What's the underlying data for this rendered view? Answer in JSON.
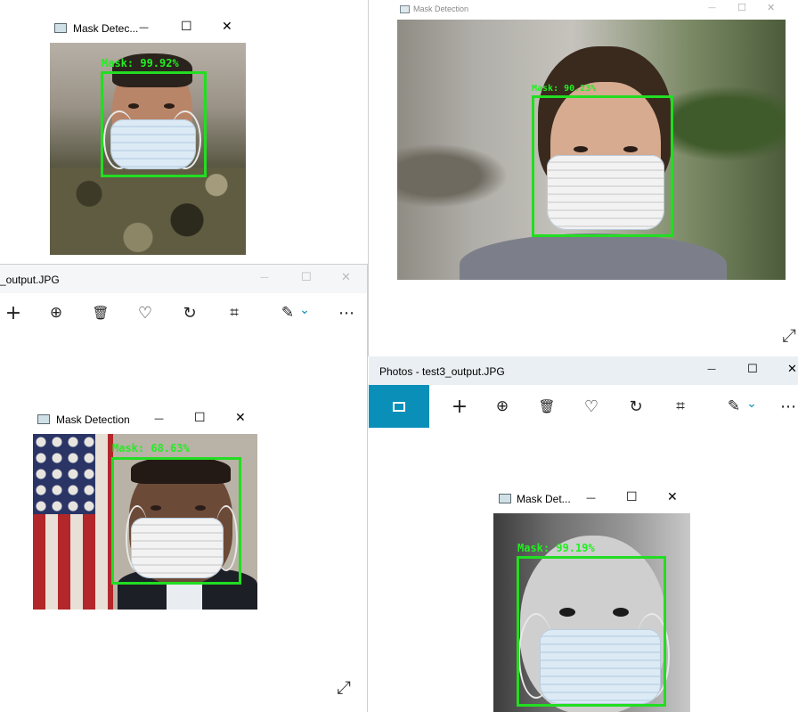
{
  "colors": {
    "detection": "#22dd22",
    "photos_accent": "#0a8fb8",
    "photos_titlebar": "#e8eef2"
  },
  "win_top_left": {
    "title": "Mask Detec...",
    "label": "Mask: 99.92%",
    "minimize_glyph": "—",
    "maximize_glyph": "☐",
    "close_glyph": "✕"
  },
  "win_top_right": {
    "title": "Mask Detection",
    "label": "Mask: 90.23%",
    "minimize_glyph": "—",
    "maximize_glyph": "☐",
    "close_glyph": "✕"
  },
  "photos_left": {
    "title": "_output.JPG",
    "minimize_glyph": "—",
    "maximize_glyph": "☐",
    "close_glyph": "✕",
    "expand_glyph": "⤢",
    "toolbar": [
      "add-icon",
      "zoom-in-icon",
      "delete-icon",
      "favorite-icon",
      "rotate-icon",
      "crop-icon",
      "edit-icon",
      "more-icon"
    ],
    "inner_window": {
      "title": "Mask Detection",
      "label": "Mask: 68.63%",
      "minimize_glyph": "—",
      "maximize_glyph": "☐",
      "close_glyph": "✕"
    }
  },
  "photos_right": {
    "title": "Photos - test3_output.JPG",
    "minimize_glyph": "—",
    "maximize_glyph": "☐",
    "close_glyph": "✕",
    "toolbar": [
      "image-icon",
      "add-icon",
      "zoom-in-icon",
      "delete-icon",
      "favorite-icon",
      "rotate-icon",
      "crop-icon",
      "edit-icon",
      "more-icon"
    ],
    "inner_window": {
      "title": "Mask Det...",
      "label": "Mask: 99.19%",
      "minimize_glyph": "—",
      "maximize_glyph": "☐",
      "close_glyph": "✕"
    }
  },
  "desktop_expand_glyph": "⤢",
  "toolbar_glyphs": {
    "add": "+",
    "zoom": "⊕",
    "delete": "🗑",
    "favorite": "♡",
    "rotate": "↻",
    "crop": "⌗",
    "edit": "✎",
    "chevron": "⌄",
    "more": "⋯"
  }
}
